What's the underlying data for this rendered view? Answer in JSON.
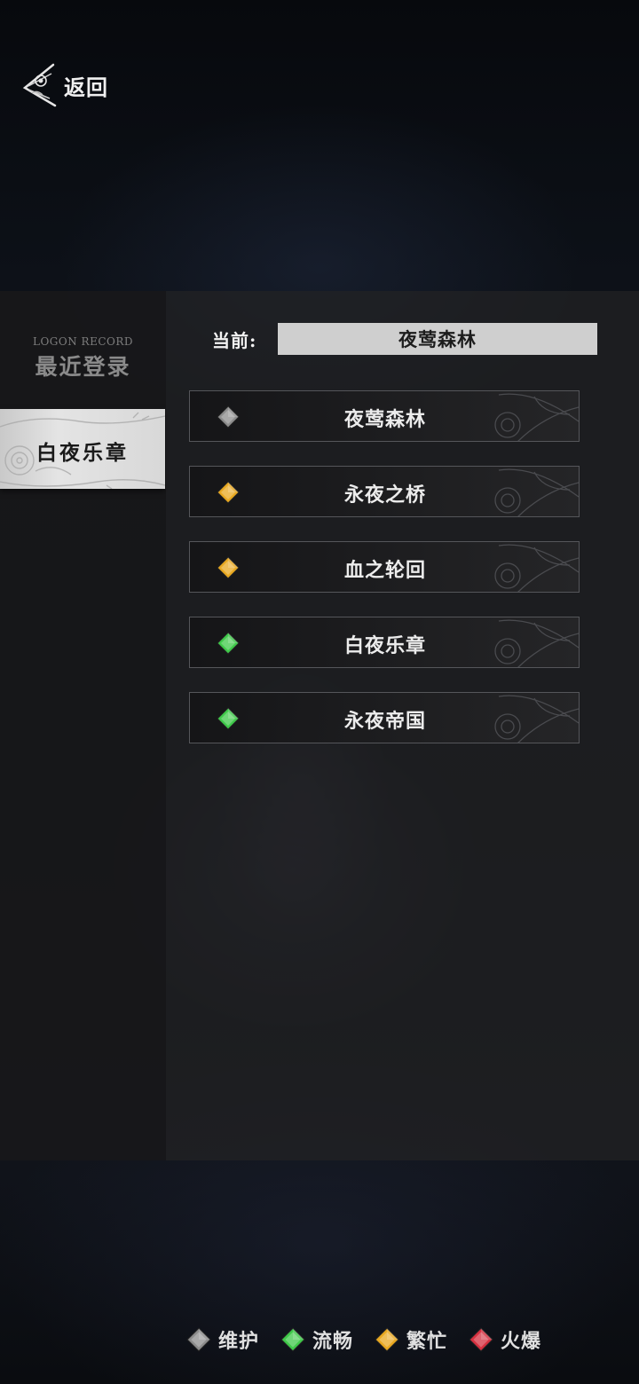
{
  "header": {
    "back_label": "返回"
  },
  "sidebar": {
    "title_en": "LOGON RECORD",
    "title_cn": "最近登录",
    "recent": [
      {
        "label": "白夜乐章"
      }
    ]
  },
  "main": {
    "current_label": "当前:",
    "current_server": "夜莺森林",
    "servers": [
      {
        "name": "夜莺森林",
        "status": "maintenance"
      },
      {
        "name": "永夜之桥",
        "status": "busy"
      },
      {
        "name": "血之轮回",
        "status": "busy"
      },
      {
        "name": "白夜乐章",
        "status": "smooth"
      },
      {
        "name": "永夜帝国",
        "status": "smooth"
      }
    ]
  },
  "legend": [
    {
      "label": "维护",
      "status": "maintenance"
    },
    {
      "label": "流畅",
      "status": "smooth"
    },
    {
      "label": "繁忙",
      "status": "busy"
    },
    {
      "label": "火爆",
      "status": "hot"
    }
  ],
  "status_colors": {
    "maintenance": "#8c8c8c",
    "smooth": "#3fc94a",
    "busy": "#e8a820",
    "hot": "#d63040"
  }
}
